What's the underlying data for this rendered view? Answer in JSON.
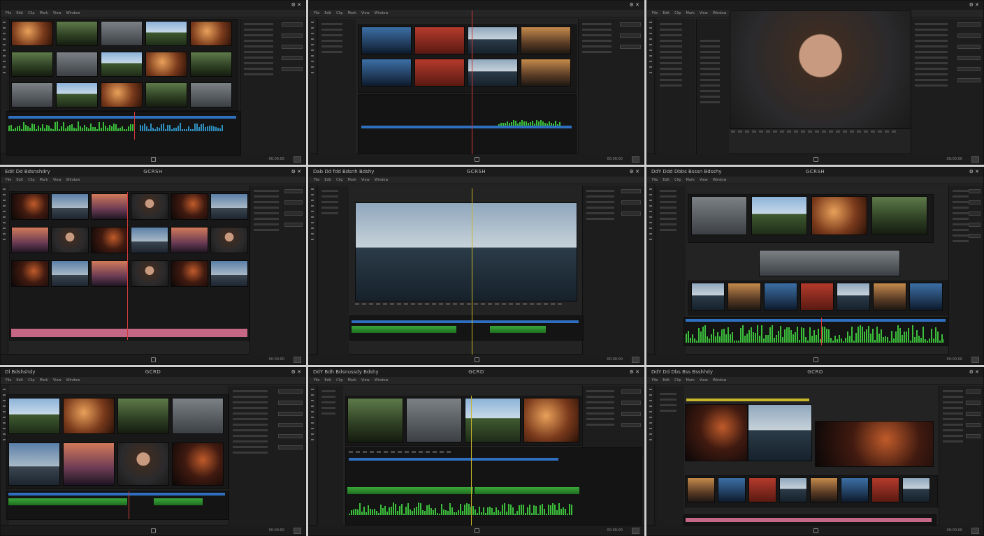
{
  "panels": [
    {
      "id": "p1",
      "title": "",
      "center": "",
      "menu": [
        "File",
        "Edit",
        "Clip",
        "Mark",
        "View",
        "Window"
      ],
      "status_left": "",
      "status_right": "00:00:00"
    },
    {
      "id": "p2",
      "title": "",
      "center": "",
      "menu": [
        "File",
        "Edit",
        "Clip",
        "Mark",
        "View",
        "Window"
      ],
      "status_left": "",
      "status_right": "00:00:00"
    },
    {
      "id": "p3",
      "title": "",
      "center": "",
      "menu": [
        "File",
        "Edit",
        "Clip",
        "Mark",
        "View",
        "Window"
      ],
      "status_left": "",
      "status_right": "00:00:00"
    },
    {
      "id": "p4",
      "title": "Edit Dd Bdsnshdry",
      "center": "GCRSH",
      "menu": [
        "File",
        "Edit",
        "Clip",
        "Mark",
        "View",
        "Window"
      ],
      "status_left": "",
      "status_right": "00:00:00"
    },
    {
      "id": "p5",
      "title": "Dab Dd fdd Bdsnh Bdshy",
      "center": "GCRSH",
      "menu": [
        "File",
        "Edit",
        "Clip",
        "Mark",
        "View",
        "Window"
      ],
      "status_left": "",
      "status_right": "00:00:00"
    },
    {
      "id": "p6",
      "title": "DdY Ddd Dbbs Bsssn Bdsshy",
      "center": "GCRSH",
      "menu": [
        "File",
        "Edit",
        "Clip",
        "Mark",
        "View",
        "Window"
      ],
      "status_left": "",
      "status_right": "00:00:00"
    },
    {
      "id": "p7",
      "title": "Dl Bdshshdy",
      "center": "GCRD",
      "menu": [
        "File",
        "Edit",
        "Clip",
        "Mark",
        "View",
        "Window"
      ],
      "status_left": "",
      "status_right": "00:00:00"
    },
    {
      "id": "p8",
      "title": "DdY Bdh Bdsnussdy Bdshy",
      "center": "GCRD",
      "menu": [
        "File",
        "Edit",
        "Clip",
        "Mark",
        "View",
        "Window"
      ],
      "status_left": "",
      "status_right": "00:00:00"
    },
    {
      "id": "p9",
      "title": "DdY Dd Dbs Bss Bsshhdy",
      "center": "GCRD",
      "menu": [
        "File",
        "Edit",
        "Clip",
        "Mark",
        "View",
        "Window"
      ],
      "status_left": "",
      "status_right": "00:00:00"
    }
  ],
  "icons": {
    "gear": "gear-icon",
    "close": "close-icon",
    "tools": "tool-icon"
  },
  "colors": {
    "background": "#232323",
    "playhead_red": "#d43a3a",
    "playhead_yellow": "#c8b52a",
    "audio_green": "#3bbf3b",
    "video_blue": "#2f6fbf",
    "clip_pink": "#c76786"
  }
}
